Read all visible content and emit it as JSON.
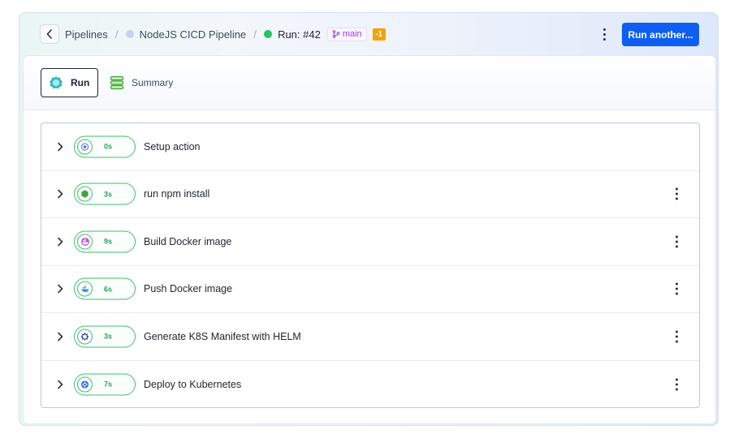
{
  "breadcrumb": {
    "pipelines": "Pipelines",
    "pipeline": "NodeJS CICD Pipeline",
    "run": "Run: #42",
    "branch": "main",
    "badge": "-1"
  },
  "header": {
    "run_another_label": "Run another..."
  },
  "tabs": {
    "run": "Run",
    "summary": "Summary"
  },
  "colors": {
    "accent": "#0e5ef0",
    "success": "#3cbf6a",
    "branch": "#9b3fd1",
    "warning": "#f6a100"
  },
  "steps": [
    {
      "name": "Setup action",
      "duration": "0s",
      "icon": "settings-gear-icon",
      "has_menu": false
    },
    {
      "name": "run npm install",
      "duration": "3s",
      "icon": "nodejs-icon",
      "has_menu": true
    },
    {
      "name": "Build Docker image",
      "duration": "9s",
      "icon": "docker-icon",
      "has_menu": true
    },
    {
      "name": "Push Docker image",
      "duration": "6s",
      "icon": "docker-icon",
      "has_menu": true
    },
    {
      "name": "Generate K8S Manifest with HELM",
      "duration": "3s",
      "icon": "helm-icon",
      "has_menu": true
    },
    {
      "name": "Deploy to Kubernetes",
      "duration": "7s",
      "icon": "kubernetes-icon",
      "has_menu": true
    }
  ]
}
